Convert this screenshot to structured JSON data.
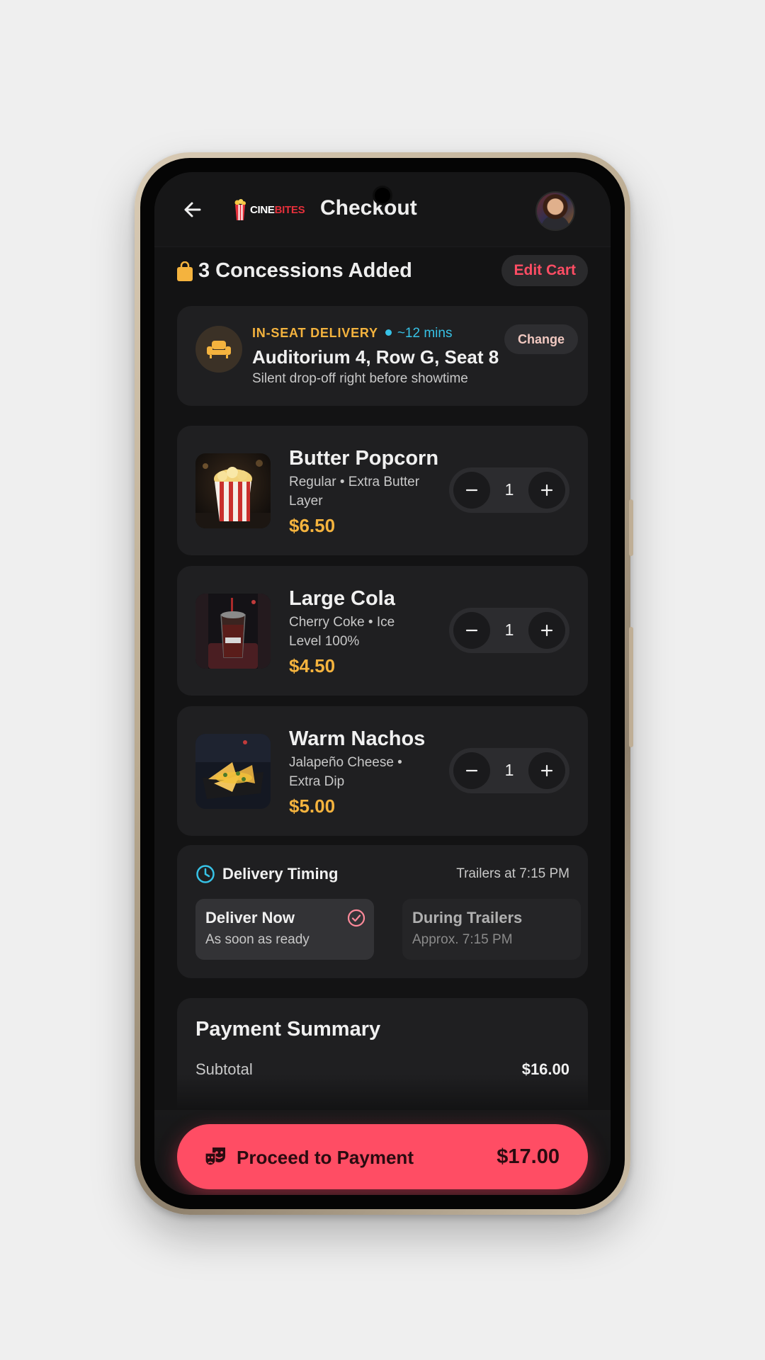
{
  "header": {
    "logo_part1": "CINE",
    "logo_part2": "BITES",
    "title": "Checkout"
  },
  "cart": {
    "count_label": "3 Concessions Added",
    "edit_label": "Edit Cart"
  },
  "delivery": {
    "tag": "IN-SEAT DELIVERY",
    "eta": "~12 mins",
    "seat": "Auditorium 4, Row G, Seat 8",
    "note": "Silent drop-off right before showtime",
    "change_label": "Change"
  },
  "items": [
    {
      "name": "Butter Popcorn",
      "desc": "Regular • Extra Butter Layer",
      "price": "$6.50",
      "qty": "1"
    },
    {
      "name": "Large Cola",
      "desc": "Cherry Coke • Ice Level 100%",
      "price": "$4.50",
      "qty": "1"
    },
    {
      "name": "Warm Nachos",
      "desc": "Jalapeño Cheese • Extra Dip",
      "price": "$5.00",
      "qty": "1"
    }
  ],
  "timing": {
    "title": "Delivery Timing",
    "trailers": "Trailers at 7:15 PM",
    "options": [
      {
        "title": "Deliver Now",
        "sub": "As soon as ready",
        "selected": true
      },
      {
        "title": "During Trailers",
        "sub": "Approx. 7:15 PM",
        "selected": false
      }
    ]
  },
  "payment": {
    "title": "Payment Summary",
    "subtotal_label": "Subtotal",
    "subtotal_value": "$16.00"
  },
  "cta": {
    "label": "Proceed to Payment",
    "total": "$17.00"
  },
  "colors": {
    "accent": "#ff4d64",
    "price": "#f4b33e",
    "info": "#37c2e6",
    "background": "#131314",
    "card": "#1f1f21"
  },
  "icons": [
    "back-arrow-icon",
    "popcorn-logo-icon",
    "shopping-bag-icon",
    "armchair-icon",
    "minus-icon",
    "plus-icon",
    "clock-icon",
    "check-circle-icon",
    "theater-masks-icon"
  ]
}
